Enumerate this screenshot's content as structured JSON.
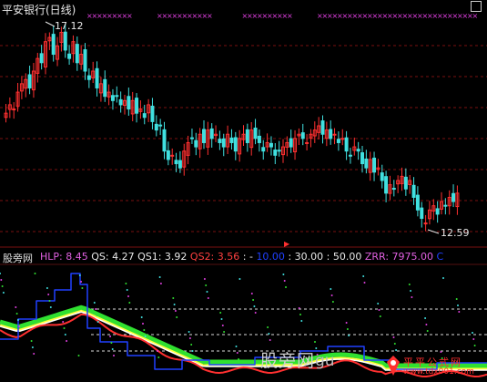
{
  "upper": {
    "title": "平安银行(日线)",
    "high_label": "17.12",
    "low_label": "12.59"
  },
  "lower": {
    "title": "股旁网",
    "indicators": [
      {
        "text": "HLP: 8.45",
        "color": "#e060e0"
      },
      {
        "text": "QS: 4.27",
        "color": "#e8e8e8"
      },
      {
        "text": "QS1: 3.92",
        "color": "#e8e8e8"
      },
      {
        "text": "QS2: 3.56",
        "color": "#ff4040"
      },
      {
        "text": ": -",
        "color": "#e8e8e8"
      },
      {
        "text": "10.00",
        "color": "#2040ff"
      },
      {
        "text": ": 30.00",
        "color": "#e8e8e8"
      },
      {
        "text": ": 50.00",
        "color": "#e8e8e8"
      },
      {
        "text": "ZRR: 7975.00",
        "color": "#e060e0"
      },
      {
        "text": "C",
        "color": "#2040ff"
      }
    ]
  },
  "watermark": {
    "cn": "股旁网",
    "url": "gu",
    "site_cn": "平平公式网",
    "site_url": "www.tdx001.com"
  },
  "colors": {
    "up": "#ff3030",
    "down": "#40e0e0",
    "magenta": "#e040e0",
    "yellow": "#ffff40",
    "green": "#30e030",
    "white": "#ffffff",
    "blue": "#2040ff",
    "red": "#ff3030"
  },
  "chart_data": {
    "type": "line",
    "title": "平安银行(日线)",
    "price_close": [
      15.2,
      15.4,
      15.3,
      15.7,
      15.9,
      16.0,
      15.8,
      16.2,
      16.5,
      16.4,
      16.9,
      17.0,
      16.6,
      16.8,
      17.12,
      16.7,
      16.5,
      16.9,
      16.4,
      16.6,
      16.2,
      16.0,
      16.2,
      15.8,
      15.9,
      15.6,
      15.7,
      15.5,
      15.6,
      15.4,
      15.5,
      15.3,
      15.5,
      15.2,
      15.3,
      15.1,
      15.4,
      15.0,
      14.8,
      14.9,
      14.3,
      14.1,
      14.2,
      14.0,
      13.9,
      14.3,
      14.5,
      14.6,
      14.4,
      14.7,
      14.5,
      14.8,
      14.6,
      14.7,
      14.5,
      14.4,
      14.7,
      14.5,
      14.3,
      14.6,
      14.7,
      14.5,
      14.8,
      14.6,
      14.5,
      14.3,
      14.5,
      14.4,
      14.2,
      14.3,
      14.4,
      14.5,
      14.4,
      14.6,
      14.7,
      14.6,
      14.5,
      14.7,
      14.8,
      14.9,
      14.7,
      14.8,
      14.6,
      14.7,
      14.5,
      14.6,
      14.3,
      14.2,
      14.4,
      14.3,
      14.0,
      13.9,
      14.1,
      13.8,
      13.9,
      13.6,
      13.3,
      13.5,
      13.4,
      13.6,
      13.7,
      13.4,
      13.6,
      13.2,
      12.9,
      12.7,
      12.59,
      12.9,
      13.0,
      12.8,
      13.1,
      13.0,
      13.2,
      13.1,
      13.3
    ],
    "high_label": 17.12,
    "low_label": 12.59,
    "indicator_series": [
      "HLP",
      "QS",
      "QS1",
      "QS2",
      "ZRR"
    ],
    "indicator_values": {
      "HLP": 8.45,
      "QS": 4.27,
      "QS1": 3.92,
      "QS2": 3.56,
      "ZRR": 7975.0
    },
    "reference_lines": [
      10.0,
      30.0,
      50.0
    ]
  }
}
